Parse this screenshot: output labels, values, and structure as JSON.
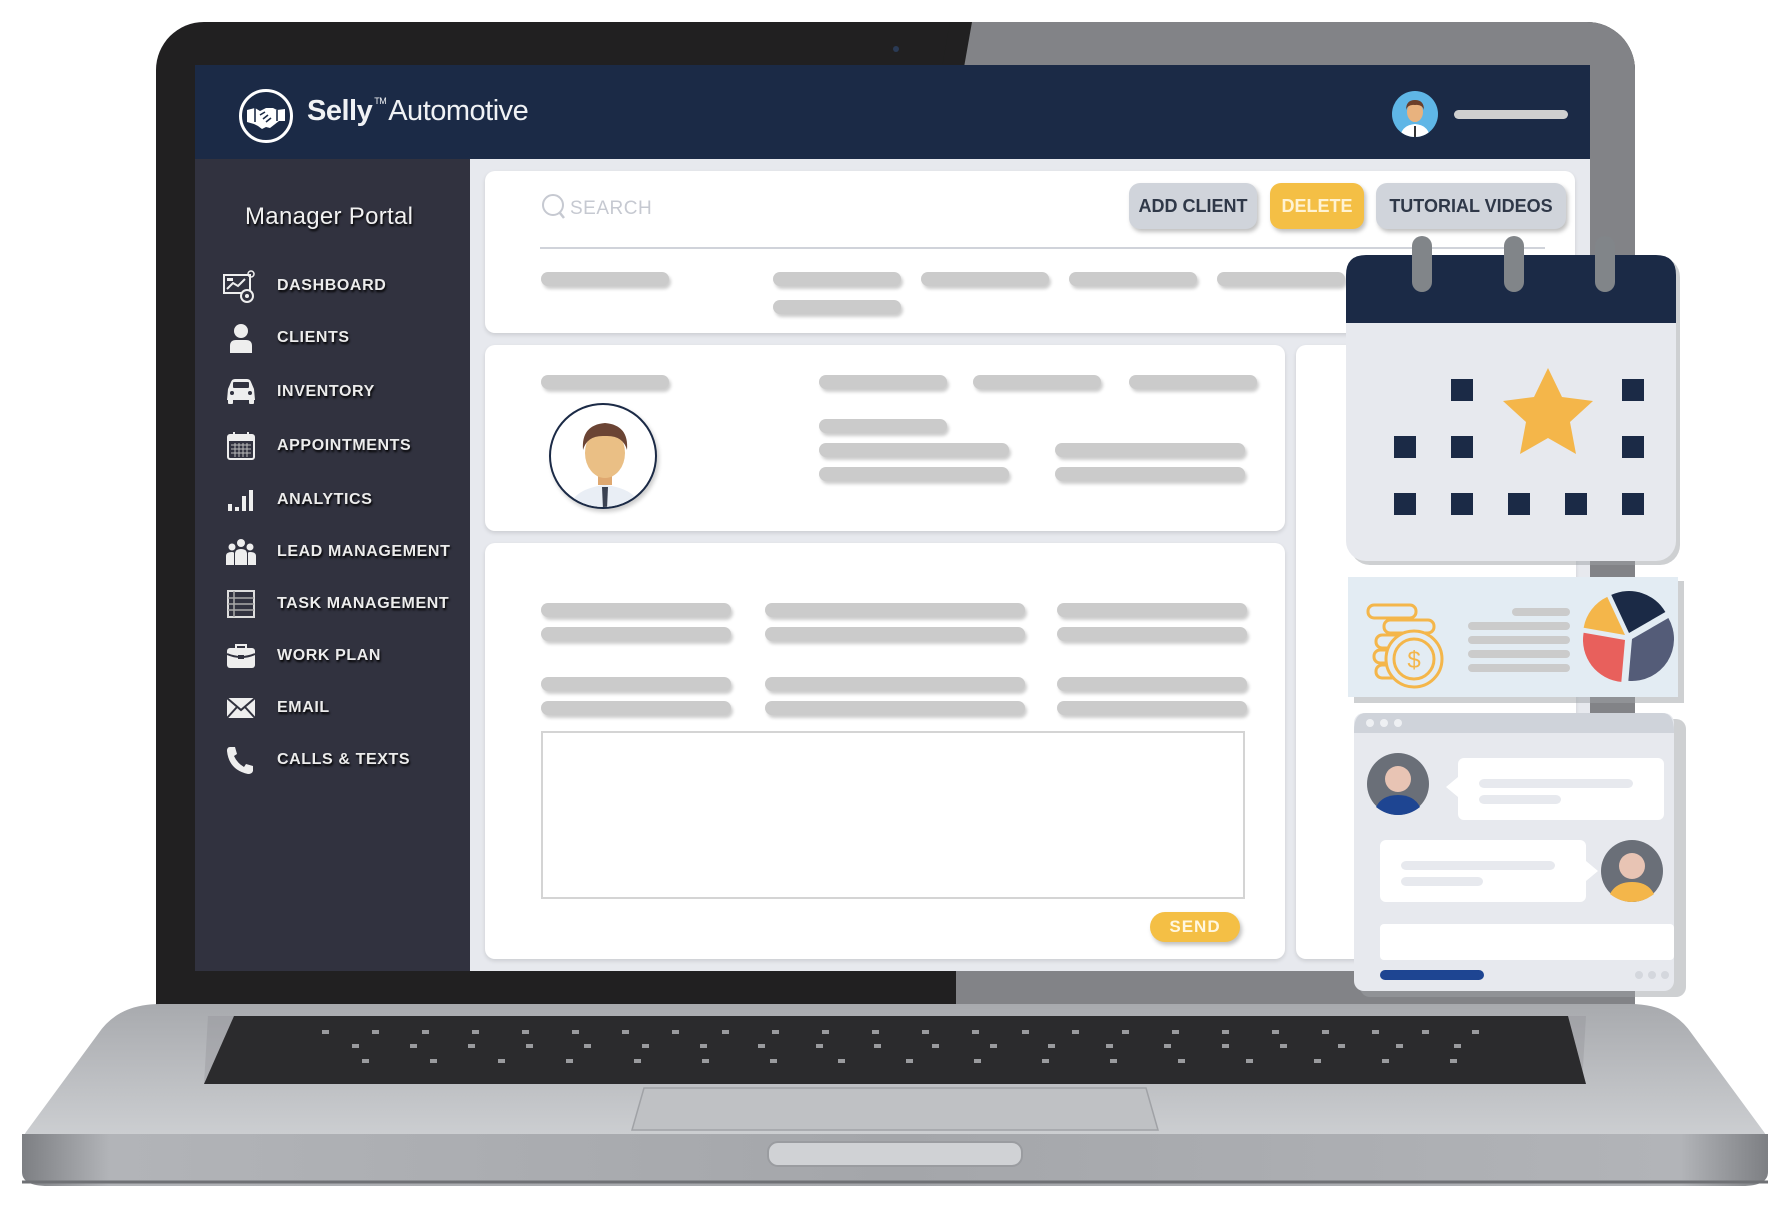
{
  "app": {
    "brand_name_bold": "Selly",
    "brand_trademark": "TM",
    "brand_name_rest": "Automotive",
    "portal_title": "Manager Portal"
  },
  "sidebar": {
    "items": [
      {
        "label": "DASHBOARD",
        "icon": "dashboard-icon"
      },
      {
        "label": "CLIENTS",
        "icon": "user-icon"
      },
      {
        "label": "INVENTORY",
        "icon": "car-icon"
      },
      {
        "label": "APPOINTMENTS",
        "icon": "calendar-icon"
      },
      {
        "label": "ANALYTICS",
        "icon": "bar-chart-icon"
      },
      {
        "label": "LEAD MANAGEMENT",
        "icon": "group-icon"
      },
      {
        "label": "TASK MANAGEMENT",
        "icon": "task-list-icon"
      },
      {
        "label": "WORK PLAN",
        "icon": "briefcase-icon"
      },
      {
        "label": "EMAIL",
        "icon": "envelope-icon"
      },
      {
        "label": "CALLS & TEXTS",
        "icon": "phone-icon"
      }
    ]
  },
  "toolbar": {
    "search_placeholder": "SEARCH",
    "add_client_label": "ADD CLIENT",
    "delete_label": "DELETE",
    "tutorial_label": "TUTORIAL VIDEOS"
  },
  "message": {
    "send_label": "SEND"
  },
  "colors": {
    "navy": "#1b2a46",
    "sidebar": "#31323f",
    "accent_yellow": "#f4bf45",
    "button_gray": "#d0d4db",
    "placeholder_gray": "#cbcbcb",
    "pie_navy": "#1b2a46",
    "pie_slate": "#545c78",
    "pie_red": "#e8605c",
    "pie_yellow": "#f4b64a",
    "chat_blue": "#1e4592"
  }
}
